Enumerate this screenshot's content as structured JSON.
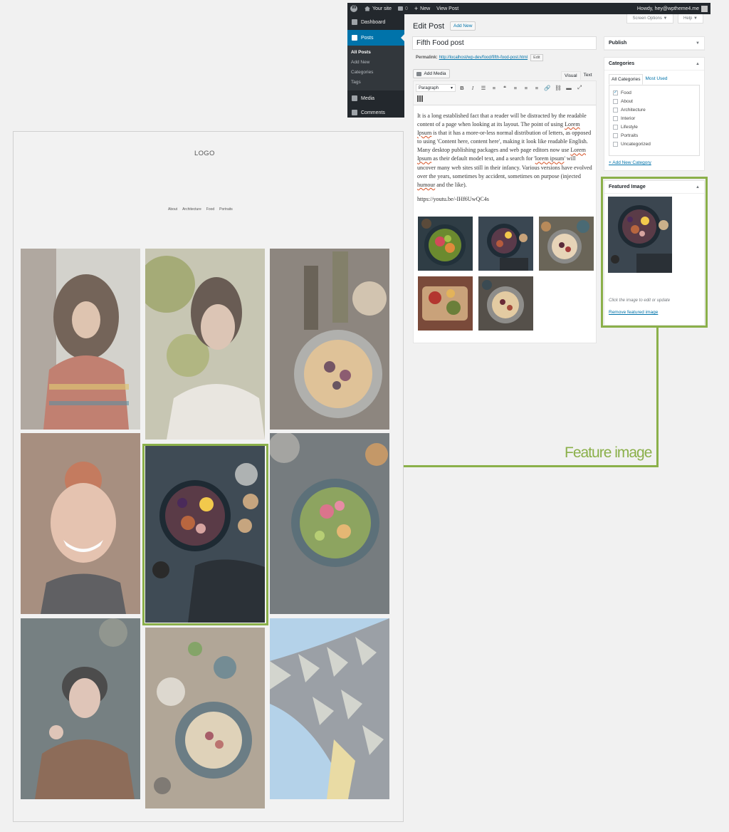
{
  "admin_bar": {
    "site_name": "Your site",
    "comments_count": "0",
    "new_label": "New",
    "view_post_label": "View Post",
    "howdy": "Howdy, hey@wptheme4.me"
  },
  "admin_menu": {
    "dashboard": "Dashboard",
    "posts": "Posts",
    "posts_sub": [
      "All Posts",
      "Add New",
      "Categories",
      "Tags"
    ],
    "media": "Media",
    "comments": "Comments"
  },
  "screen_options": "Screen Options ▼",
  "help": "Help ▼",
  "editor": {
    "page_title": "Edit Post",
    "add_new_label": "Add New",
    "post_title": "Fifth Food post",
    "permalink_label": "Permalink:",
    "permalink_url": "http://localhost/wp-dev/food/fifth-food-post.html",
    "permalink_edit": "Edit",
    "add_media": "Add Media",
    "tab_visual": "Visual",
    "tab_text": "Text",
    "format_select": "Paragraph",
    "content": {
      "p1_a": "It is a long established fact that a reader will be distracted by the readable content of a page when looking at its layout. The point of using ",
      "p1_lorem1": "Lorem Ipsum",
      "p1_b": " is that it has a more-or-less normal distribution of letters, as opposed to using 'Content here, content here', making it look like readable English. Many desktop publishing packages and web page editors now use ",
      "p1_lorem2": "Lorem Ipsum",
      "p1_c": " as their default model text, and a search for '",
      "p1_lorem3": "lorem ipsum",
      "p1_d": "' will uncover many web sites still in their infancy. Various versions have evolved over the years, sometimes by accident, sometimes on purpose (injected ",
      "p1_humour": "humour",
      "p1_e": " and the like).",
      "video_url": "https://youtu.be/-IHf6UwQC4s"
    }
  },
  "publish_box": {
    "title": "Publish"
  },
  "categories_box": {
    "title": "Categories",
    "tab_all": "All Categories",
    "tab_most_used": "Most Used",
    "items": [
      {
        "label": "Food",
        "checked": true
      },
      {
        "label": "About",
        "checked": false
      },
      {
        "label": "Architecture",
        "checked": false
      },
      {
        "label": "Interior",
        "checked": false
      },
      {
        "label": "Lifestyle",
        "checked": false
      },
      {
        "label": "Portraits",
        "checked": false
      },
      {
        "label": "Uncategorized",
        "checked": false
      }
    ],
    "add_new": "+ Add New Category"
  },
  "featured_box": {
    "title": "Featured Image",
    "hint": "Click the image to edit or update",
    "remove": "Remove featured image"
  },
  "callout_label": "Feature image",
  "preview": {
    "logo": "LOGO",
    "nav": [
      "About",
      "Architecture",
      "Food",
      "Portraits"
    ]
  },
  "colors": {
    "accent_green": "#8bb04a",
    "wp_blue": "#0073aa",
    "admin_dark": "#23282d"
  }
}
